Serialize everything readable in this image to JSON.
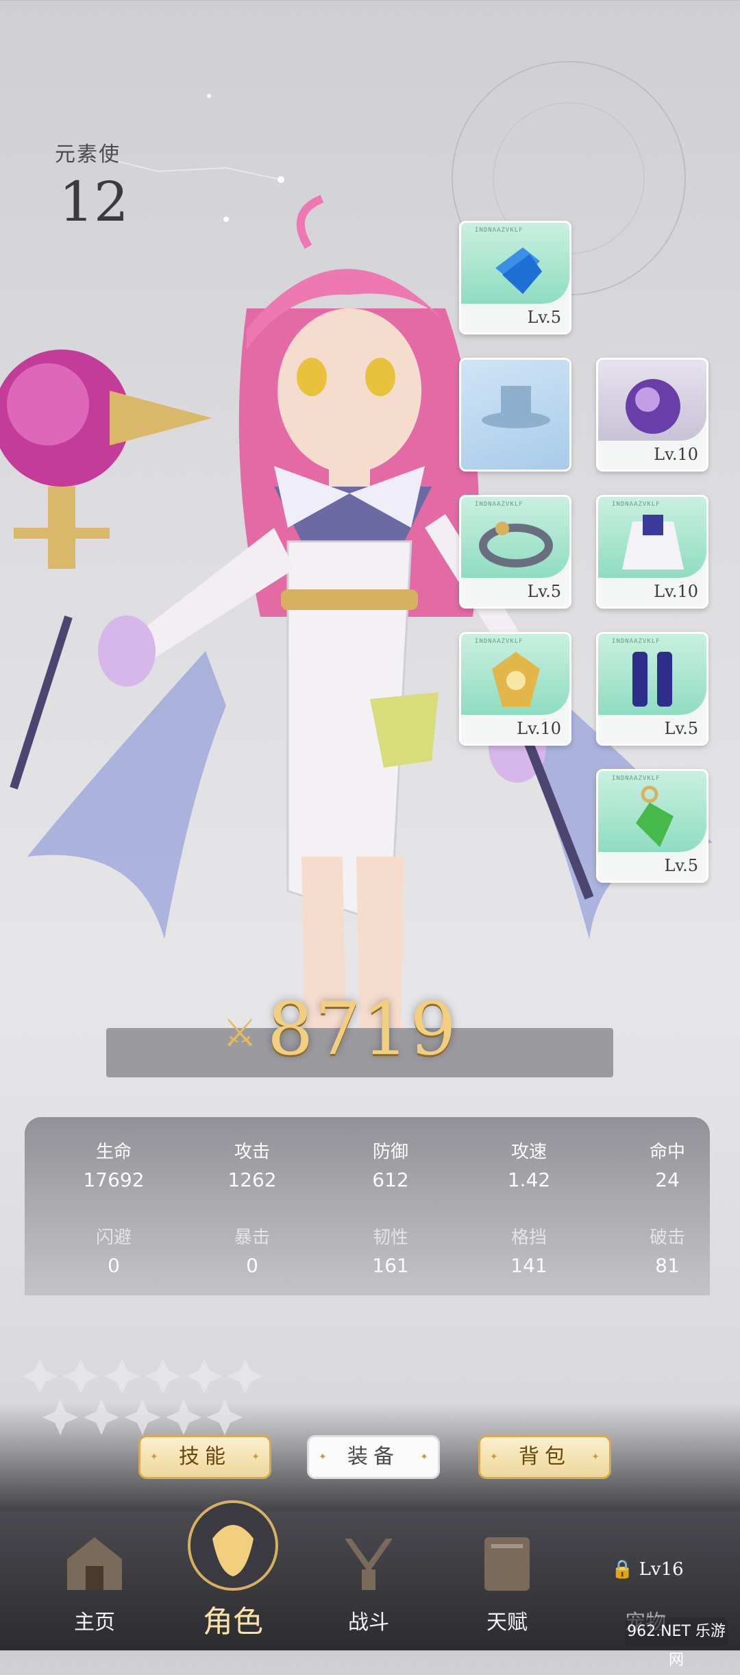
{
  "header": {
    "class_label": "元素使",
    "number": "12"
  },
  "equipment": [
    {
      "slot": "gem",
      "level": "Lv.5",
      "tiny": "INDNAAZVKLF"
    },
    {
      "slot": "hat-empty",
      "level": ""
    },
    {
      "slot": "orb",
      "level": "Lv.10"
    },
    {
      "slot": "ring",
      "level": "Lv.5",
      "tiny": "INDNAAZVKLF"
    },
    {
      "slot": "cape",
      "level": "Lv.10",
      "tiny": "INDNAAZVKLF"
    },
    {
      "slot": "crest",
      "level": "Lv.10",
      "tiny": "INDNAAZVKLF"
    },
    {
      "slot": "boots",
      "level": "Lv.5",
      "tiny": "INDNAAZVKLF"
    },
    {
      "slot": "pendant",
      "level": "Lv.5",
      "tiny": "INDNAAZVKLF"
    }
  ],
  "power": "8719",
  "stats": [
    {
      "label": "生命",
      "value": "17692"
    },
    {
      "label": "攻击",
      "value": "1262"
    },
    {
      "label": "防御",
      "value": "612"
    },
    {
      "label": "攻速",
      "value": "1.42"
    },
    {
      "label": "命中",
      "value": "24"
    },
    {
      "label": "闪避",
      "value": "0"
    },
    {
      "label": "暴击",
      "value": "0"
    },
    {
      "label": "韧性",
      "value": "161"
    },
    {
      "label": "格挡",
      "value": "141"
    },
    {
      "label": "破击",
      "value": "81"
    }
  ],
  "tabs": {
    "skills": "技能",
    "equip": "装备",
    "bag": "背包"
  },
  "nav": {
    "home": "主页",
    "role": "角色",
    "battle": "战斗",
    "talent": "天赋",
    "pet": "宠物",
    "lock_level": "Lv16"
  },
  "watermark": "962.NET 乐游网",
  "colors": {
    "gold": "#f2cf7e",
    "mint": "#8fdcc1",
    "panel": "#6e6e76"
  }
}
